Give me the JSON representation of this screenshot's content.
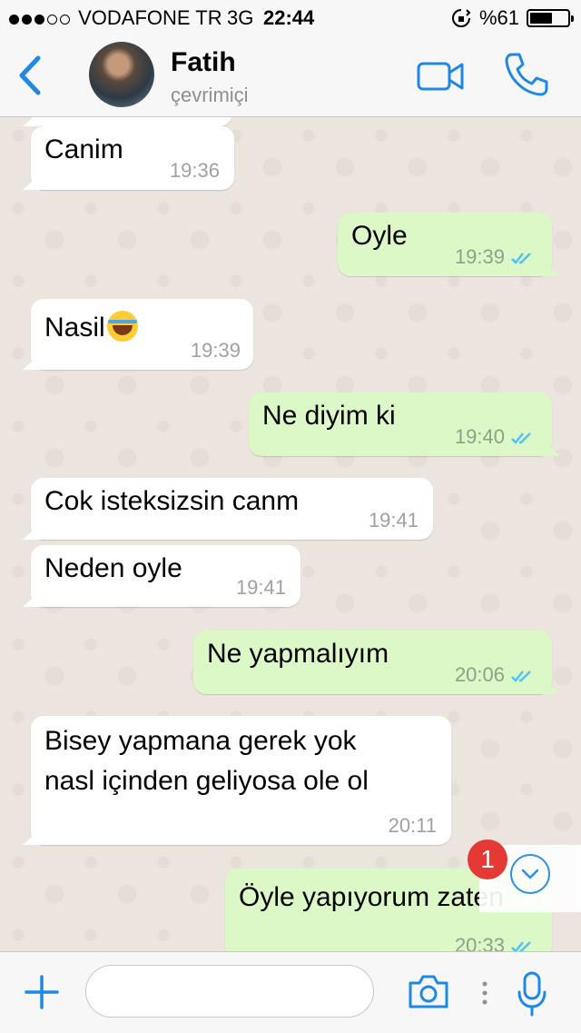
{
  "status_bar": {
    "carrier": "VODAFONE TR",
    "network": "3G",
    "time": "22:44",
    "battery": "%61",
    "battery_level": 0.61,
    "signal_bars": 3
  },
  "header": {
    "back_icon": "chevron-left-icon",
    "contact_name": "Fatih",
    "contact_status": "çevrimiçi",
    "video_icon": "video-camera-icon",
    "call_icon": "phone-icon"
  },
  "messages": [
    {
      "dir": "in",
      "text": "Canim",
      "time": "19:36"
    },
    {
      "dir": "out",
      "text": "Oyle",
      "time": "19:39",
      "read": true
    },
    {
      "dir": "in",
      "text": "Nasil",
      "time": "19:39",
      "emoji": "face-with-tears-of-joy"
    },
    {
      "dir": "out",
      "text": "Ne diyim ki",
      "time": "19:40",
      "read": true
    },
    {
      "dir": "in",
      "text": "Cok isteksizsin canm",
      "time": "19:41"
    },
    {
      "dir": "in",
      "text": "Neden oyle",
      "time": "19:41"
    },
    {
      "dir": "out",
      "text": "Ne yapmalıyım",
      "time": "20:06",
      "read": true
    },
    {
      "dir": "in",
      "text": [
        "Bisey yapmana gerek yok",
        "nasl içinden geliyosa ole ol"
      ],
      "time": "20:11"
    },
    {
      "dir": "out",
      "text": "Öyle yapıyorum zaten",
      "time": "20:33",
      "read": true
    }
  ],
  "unread_badge": "1",
  "colors": {
    "accent": "#1e88e5",
    "outgoing_bubble": "#dcf8c6",
    "incoming_bubble": "#ffffff",
    "chat_background": "#ece5dd",
    "read_ticks": "#4fc3f7",
    "badge": "#e53935"
  },
  "input_bar": {
    "placeholder": "",
    "icons": [
      "plus-icon",
      "camera-icon",
      "more-dots-icon",
      "microphone-icon"
    ]
  }
}
